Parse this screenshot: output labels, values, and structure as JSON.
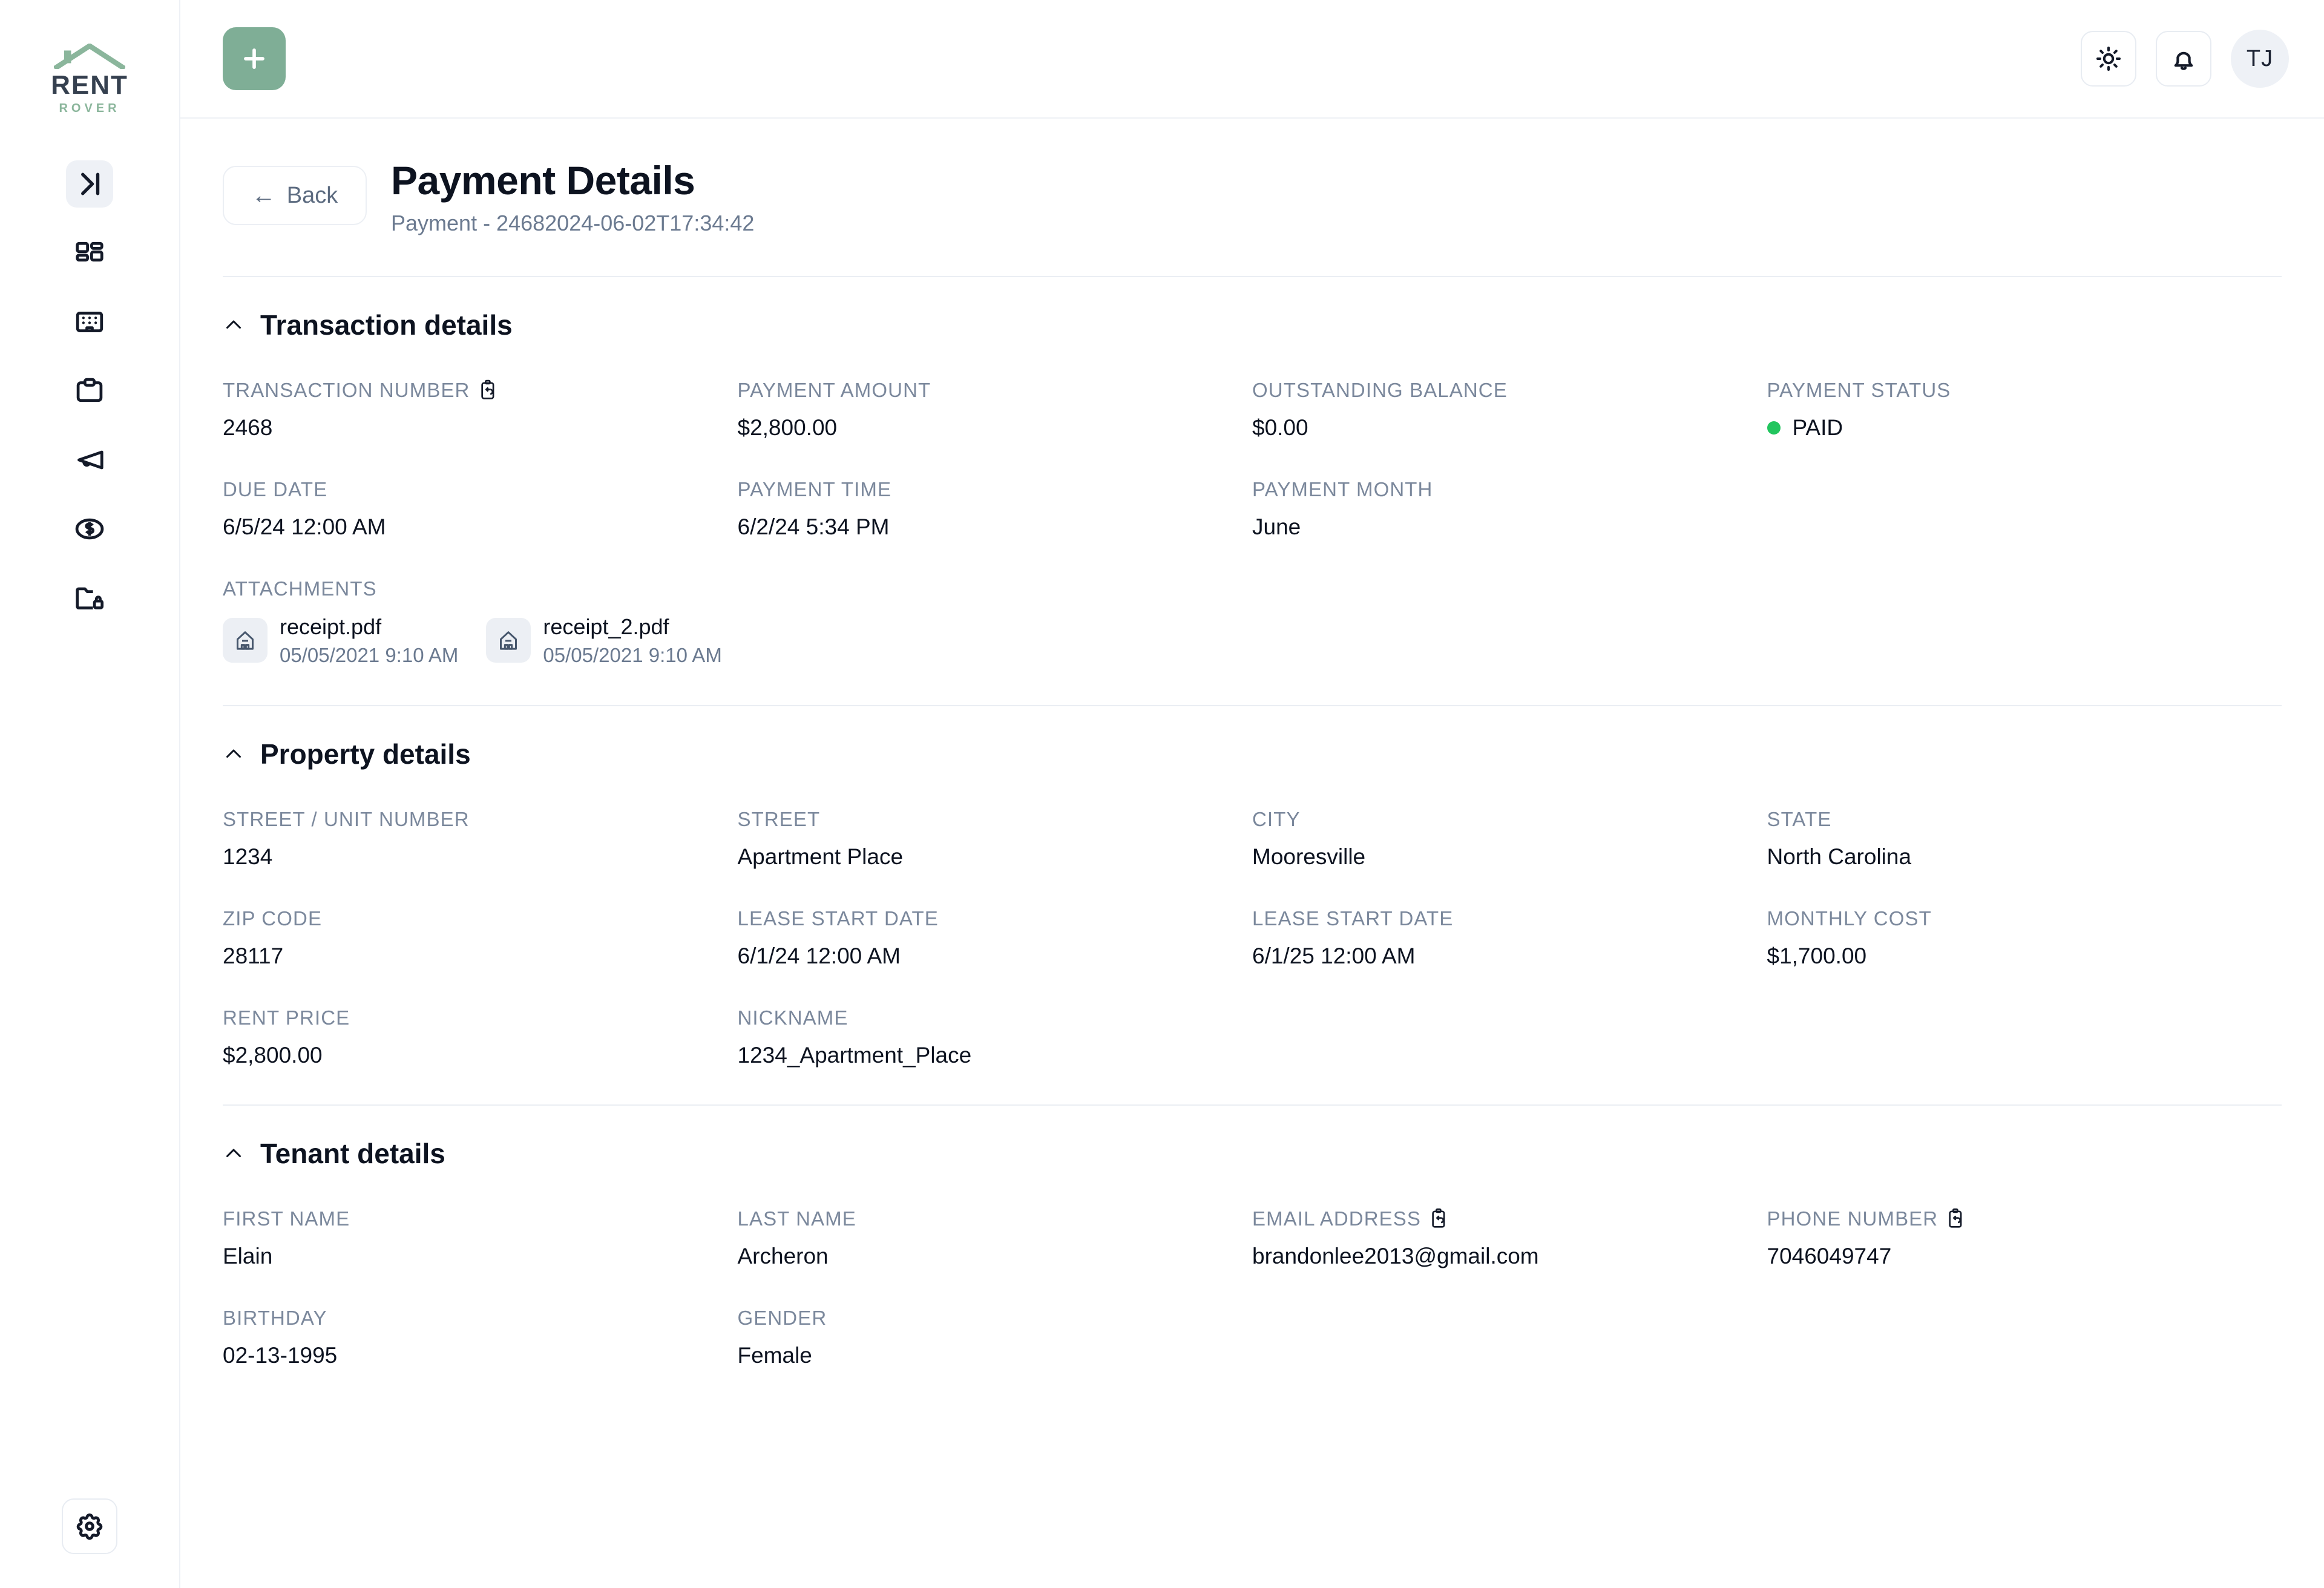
{
  "brand": {
    "name_top": "RENT",
    "name_bottom": "ROVER",
    "icon": "house-roof-icon",
    "green": "#8bb69c",
    "dark": "#35404f"
  },
  "sidebar": {
    "items": [
      {
        "name": "sidebar-toggle-expand",
        "icon": "chevron-right-bar-icon",
        "active": true
      },
      {
        "name": "sidebar-item-dashboard",
        "icon": "dashboard-grid-icon",
        "active": false
      },
      {
        "name": "sidebar-item-properties",
        "icon": "building-icon",
        "active": false
      },
      {
        "name": "sidebar-item-tasks",
        "icon": "clipboard-icon",
        "active": false
      },
      {
        "name": "sidebar-item-announcements",
        "icon": "megaphone-icon",
        "active": false
      },
      {
        "name": "sidebar-item-payments",
        "icon": "dollar-circle-icon",
        "active": false
      },
      {
        "name": "sidebar-item-documents",
        "icon": "folder-lock-icon",
        "active": false
      }
    ],
    "settings": {
      "name": "sidebar-settings",
      "icon": "gear-icon"
    }
  },
  "topbar": {
    "add_button": {
      "label": "+",
      "icon": "plus-icon",
      "color": "#7FAE96"
    },
    "theme_toggle": {
      "icon": "sun-icon"
    },
    "notifications": {
      "icon": "bell-icon"
    },
    "avatar": {
      "initials": "TJ"
    }
  },
  "page": {
    "back_label": "Back",
    "back_icon": "arrow-left-icon",
    "title": "Payment Details",
    "subtitle": "Payment - 24682024-06-02T17:34:42"
  },
  "sections": {
    "transaction": {
      "title": "Transaction details",
      "collapse_icon": "chevron-up-icon",
      "fields": [
        {
          "label": "TRANSACTION NUMBER",
          "value": "2468",
          "copy": true
        },
        {
          "label": "PAYMENT AMOUNT",
          "value": "$2,800.00",
          "copy": false
        },
        {
          "label": "OUTSTANDING BALANCE",
          "value": "$0.00",
          "copy": false
        },
        {
          "label": "PAYMENT STATUS",
          "value": "PAID",
          "copy": false,
          "status": true,
          "status_color": "#22c55e"
        },
        {
          "label": "DUE DATE",
          "value": "6/5/24 12:00 AM",
          "copy": false
        },
        {
          "label": "PAYMENT TIME",
          "value": "6/2/24 5:34 PM",
          "copy": false
        },
        {
          "label": "PAYMENT MONTH",
          "value": "June",
          "copy": false
        }
      ],
      "attachments_label": "ATTACHMENTS",
      "attachments": [
        {
          "name": "receipt.pdf",
          "date": "05/05/2021 9:10 AM",
          "icon": "home-file-icon"
        },
        {
          "name": "receipt_2.pdf",
          "date": "05/05/2021 9:10 AM",
          "icon": "home-file-icon"
        }
      ]
    },
    "property": {
      "title": "Property details",
      "collapse_icon": "chevron-up-icon",
      "fields": [
        {
          "label": "STREET / UNIT NUMBER",
          "value": "1234",
          "copy": false
        },
        {
          "label": "STREET",
          "value": "Apartment Place",
          "copy": false
        },
        {
          "label": "CITY",
          "value": "Mooresville",
          "copy": false
        },
        {
          "label": "STATE",
          "value": "North Carolina",
          "copy": false
        },
        {
          "label": "ZIP CODE",
          "value": "28117",
          "copy": false
        },
        {
          "label": "LEASE START DATE",
          "value": "6/1/24 12:00 AM",
          "copy": false
        },
        {
          "label": "LEASE START DATE",
          "value": "6/1/25 12:00 AM",
          "copy": false
        },
        {
          "label": "MONTHLY COST",
          "value": "$1,700.00",
          "copy": false
        },
        {
          "label": "RENT PRICE",
          "value": "$2,800.00",
          "copy": false
        },
        {
          "label": "NICKNAME",
          "value": "1234_Apartment_Place",
          "copy": false
        }
      ]
    },
    "tenant": {
      "title": "Tenant details",
      "collapse_icon": "chevron-up-icon",
      "fields": [
        {
          "label": "FIRST NAME",
          "value": "Elain",
          "copy": false
        },
        {
          "label": "LAST NAME",
          "value": "Archeron",
          "copy": false
        },
        {
          "label": "EMAIL ADDRESS",
          "value": "brandonlee2013@gmail.com",
          "copy": true
        },
        {
          "label": "PHONE NUMBER",
          "value": "7046049747",
          "copy": true
        },
        {
          "label": "BIRTHDAY",
          "value": "02-13-1995",
          "copy": false
        },
        {
          "label": "GENDER",
          "value": "Female",
          "copy": false
        }
      ]
    }
  }
}
